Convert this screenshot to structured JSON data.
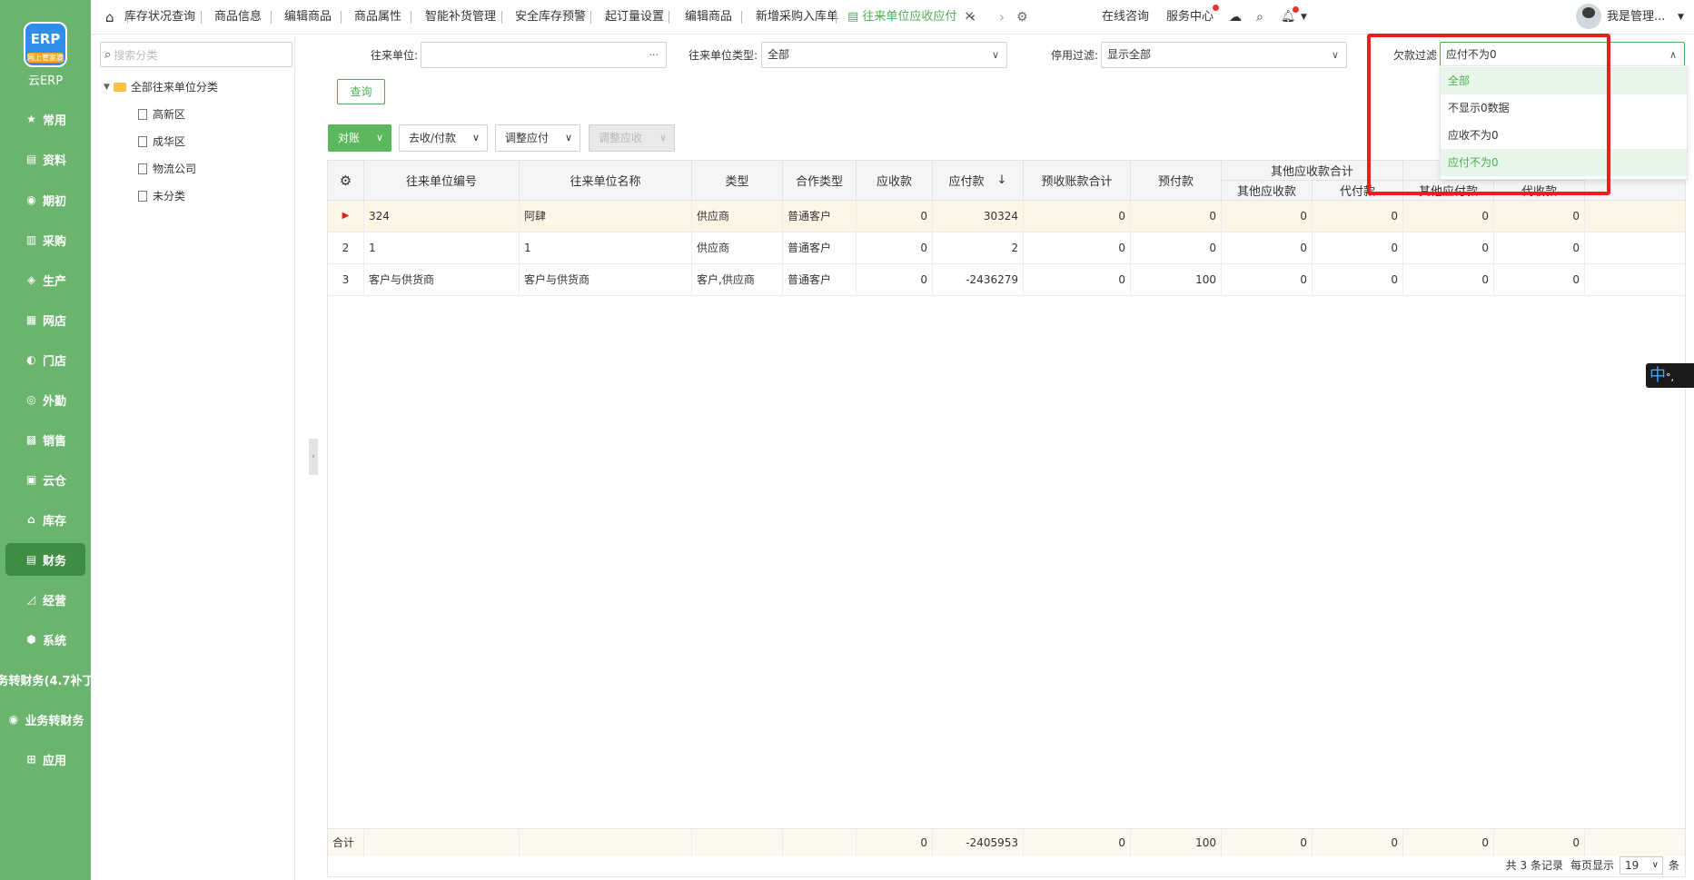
{
  "brand": {
    "logo_text": "ERP",
    "logo_sub": "网上管家婆",
    "name": "云ERP"
  },
  "sidebar": [
    {
      "label": "常用",
      "icon": "star-icon",
      "glyph": "★"
    },
    {
      "label": "资料",
      "icon": "document-icon",
      "glyph": "▤"
    },
    {
      "label": "期初",
      "icon": "target-icon",
      "glyph": "◉"
    },
    {
      "label": "采购",
      "icon": "cart-icon",
      "glyph": "▥"
    },
    {
      "label": "生产",
      "icon": "production-icon",
      "glyph": "◈"
    },
    {
      "label": "网店",
      "icon": "shop-icon",
      "glyph": "▦"
    },
    {
      "label": "门店",
      "icon": "store-icon",
      "glyph": "◐"
    },
    {
      "label": "外勤",
      "icon": "field-icon",
      "glyph": "◎"
    },
    {
      "label": "销售",
      "icon": "sales-icon",
      "glyph": "▩"
    },
    {
      "label": "云仓",
      "icon": "warehouse-icon",
      "glyph": "▣"
    },
    {
      "label": "库存",
      "icon": "home-icon",
      "glyph": "⌂"
    },
    {
      "label": "财务",
      "icon": "finance-icon",
      "glyph": "▤"
    },
    {
      "label": "经营",
      "icon": "chart-icon",
      "glyph": "◿"
    },
    {
      "label": "系统",
      "icon": "settings-icon",
      "glyph": "⬢"
    },
    {
      "label": "务转财务(4.7补丁",
      "icon": "",
      "glyph": ""
    },
    {
      "label": "业务转财务",
      "icon": "convert-icon",
      "glyph": "◉"
    },
    {
      "label": "应用",
      "icon": "plus-icon",
      "glyph": "⊞"
    }
  ],
  "tree": {
    "search_placeholder": "搜索分类",
    "root": "全部往来单位分类",
    "children": [
      "高新区",
      "成华区",
      "物流公司",
      "未分类"
    ]
  },
  "tabs": [
    "库存状况查询",
    "商品信息",
    "编辑商品",
    "商品属性",
    "智能补货管理",
    "安全库存预警",
    "起订量设置",
    "编辑商品",
    "新增采购入库单",
    "往来单位应收应付"
  ],
  "topbar": {
    "consult": "在线咨询",
    "service": "服务中心",
    "user": "我是管理..."
  },
  "filters": {
    "unit_label": "往来单位:",
    "unit_value": "",
    "unit_type_label": "往来单位类型:",
    "unit_type_value": "全部",
    "disable_label": "停用过滤:",
    "disable_value": "显示全部",
    "debt_label": "欠款过滤",
    "debt_value": "应付不为0",
    "query_button": "查询"
  },
  "dropdown_options": [
    "全部",
    "不显示0数据",
    "应收不为0",
    "应付不为0"
  ],
  "toolbar": {
    "reconcile": "对账",
    "payment": "去收/付款",
    "adjust_payable": "调整应付",
    "adjust_receivable": "调整应收"
  },
  "table": {
    "headers": [
      "往来单位编号",
      "往来单位名称",
      "类型",
      "合作类型",
      "应收款",
      "应付款",
      "预收账款合计",
      "预付款"
    ],
    "group_other_receivable": "其他应收款合计",
    "sub_other_receivable": "其他应收款",
    "sub_paid_for": "代付款",
    "sub_other_payable": "其他应付款",
    "sub_collected_for": "代收款",
    "rows": [
      {
        "idx": "1",
        "code": "324",
        "name": "阿肆",
        "type": "供应商",
        "coop": "普通客户",
        "receivable": "0",
        "payable": "30324",
        "prerecv": "0",
        "prepay": "0",
        "other_recv": "0",
        "paid_for": "0",
        "other_pay": "0",
        "collected_for": "0"
      },
      {
        "idx": "2",
        "code": "1",
        "name": "1",
        "type": "供应商",
        "coop": "普通客户",
        "receivable": "0",
        "payable": "2",
        "prerecv": "0",
        "prepay": "0",
        "other_recv": "0",
        "paid_for": "0",
        "other_pay": "0",
        "collected_for": "0"
      },
      {
        "idx": "3",
        "code": "客户与供货商",
        "name": "客户与供货商",
        "type": "客户,供应商",
        "coop": "普通客户",
        "receivable": "0",
        "payable": "-2436279",
        "prerecv": "0",
        "prepay": "100",
        "other_recv": "0",
        "paid_for": "0",
        "other_pay": "0",
        "collected_for": "0"
      }
    ],
    "footer": {
      "label": "合计",
      "receivable": "0",
      "payable": "-2405953",
      "prerecv": "0",
      "prepay": "100",
      "other_recv": "0",
      "paid_for": "0",
      "other_pay": "0",
      "collected_for": "0"
    }
  },
  "pager": {
    "total": "共 3 条记录",
    "per_page_label": "每页显示",
    "per_page": "19",
    "unit": "条"
  },
  "ime": {
    "mode": "中",
    "punct": "°,"
  },
  "colors": {
    "sidebar": "#6bb46e",
    "accent": "#4caf50",
    "highlight": "#ee1c1c"
  }
}
